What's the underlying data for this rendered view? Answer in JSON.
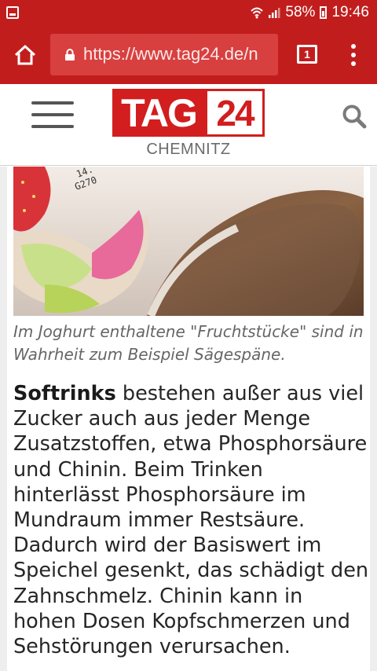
{
  "status_bar": {
    "battery_percent": "58%",
    "time": "19:46"
  },
  "browser": {
    "url": "https://www.tag24.de/n",
    "tab_count": "1",
    "theme_color": "#c21d1d"
  },
  "site": {
    "logo_word": "TAG",
    "logo_number": "24",
    "city": "CHEMNITZ",
    "brand_color": "#d21e1e"
  },
  "article": {
    "caption": "Im Joghurt enthaltene \"Fruchtstücke\" sind in Wahrheit zum Beispiel Sägespäne.",
    "lead_word": "Softrinks",
    "paragraph": " bestehen außer aus viel Zucker auch aus jeder Menge Zusatzstoffen, etwa Phosphorsäure und Chinin. Beim Trinken hinterlässt Phosphorsäure im Mundraum immer Restsäure. Dadurch wird der Basiswert im Speichel gesenkt, das schädigt den Zahnschmelz. Chinin kann in hohen Dosen Kopfschmerzen und Sehstörungen verursachen.",
    "photo_print_text": [
      "14.",
      "G270"
    ]
  },
  "icons": {
    "status_left": "gallery-notification-icon",
    "wifi": "wifi-icon",
    "signal": "signal-icon",
    "battery": "battery-icon",
    "home": "home-icon",
    "lock": "lock-icon",
    "menu_site": "hamburger-menu-icon",
    "search": "search-icon",
    "overflow": "more-vert-icon"
  }
}
